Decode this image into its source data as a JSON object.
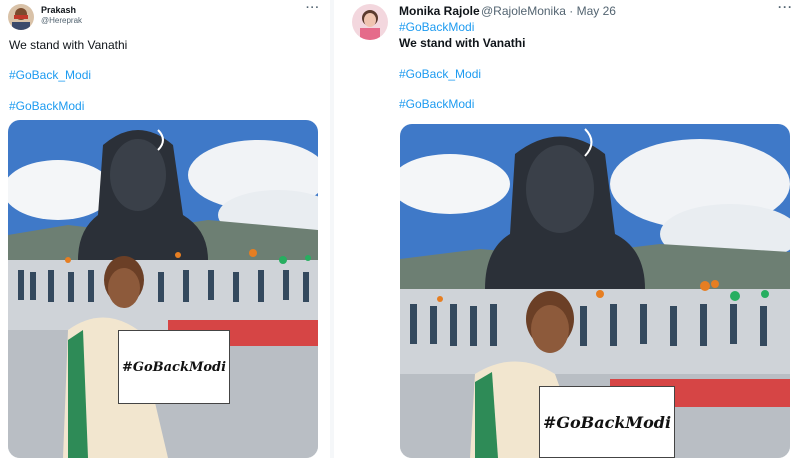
{
  "left_tweet": {
    "author_name": "Prakash",
    "author_handle": "@Hereprak",
    "more_icon": "more-horizontal-icon",
    "text": "We stand with Vanathi",
    "hashtags": [
      "#GoBack_Modi",
      "#GoBackModi"
    ],
    "placard_text": "#GoBackModi"
  },
  "right_tweet": {
    "author_name": "Monika Rajole",
    "author_handle": "@RajoleMonika",
    "separator": "·",
    "date": "May 26",
    "more_icon": "more-horizontal-icon",
    "hashtag_top": "#GoBackModi",
    "text": "We stand with Vanathi",
    "hashtags": [
      "#GoBack_Modi",
      "#GoBackModi"
    ],
    "placard_text": "#GoBackModi"
  },
  "colors": {
    "link": "#1d9bf0",
    "muted": "#536471",
    "text": "#0f1419"
  }
}
